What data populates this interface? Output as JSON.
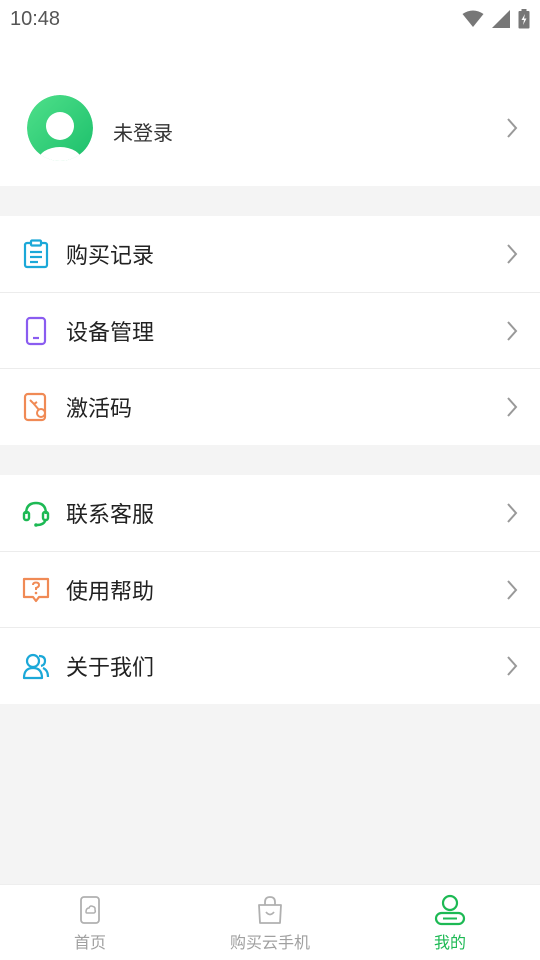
{
  "status_bar": {
    "time": "10:48"
  },
  "profile": {
    "login_label": "未登录"
  },
  "menu_group_1": [
    {
      "label": "购买记录",
      "icon": "clipboard-icon",
      "color": "#1ba8d8"
    },
    {
      "label": "设备管理",
      "icon": "phone-device-icon",
      "color": "#8a5cf0"
    },
    {
      "label": "激活码",
      "icon": "activation-code-icon",
      "color": "#f08a55"
    }
  ],
  "menu_group_2": [
    {
      "label": "联系客服",
      "icon": "headset-icon",
      "color": "#1db954"
    },
    {
      "label": "使用帮助",
      "icon": "help-icon",
      "color": "#f08a55"
    },
    {
      "label": "关于我们",
      "icon": "users-icon",
      "color": "#1ba8d8"
    }
  ],
  "tabbar": {
    "tabs": [
      {
        "label": "首页",
        "icon": "home-phone-icon",
        "active": false
      },
      {
        "label": "购买云手机",
        "icon": "shopping-bag-icon",
        "active": false
      },
      {
        "label": "我的",
        "icon": "profile-icon",
        "active": true
      }
    ]
  },
  "colors": {
    "accent": "#1db954",
    "inactive": "#a0a0a0",
    "background": "#f4f4f4"
  }
}
